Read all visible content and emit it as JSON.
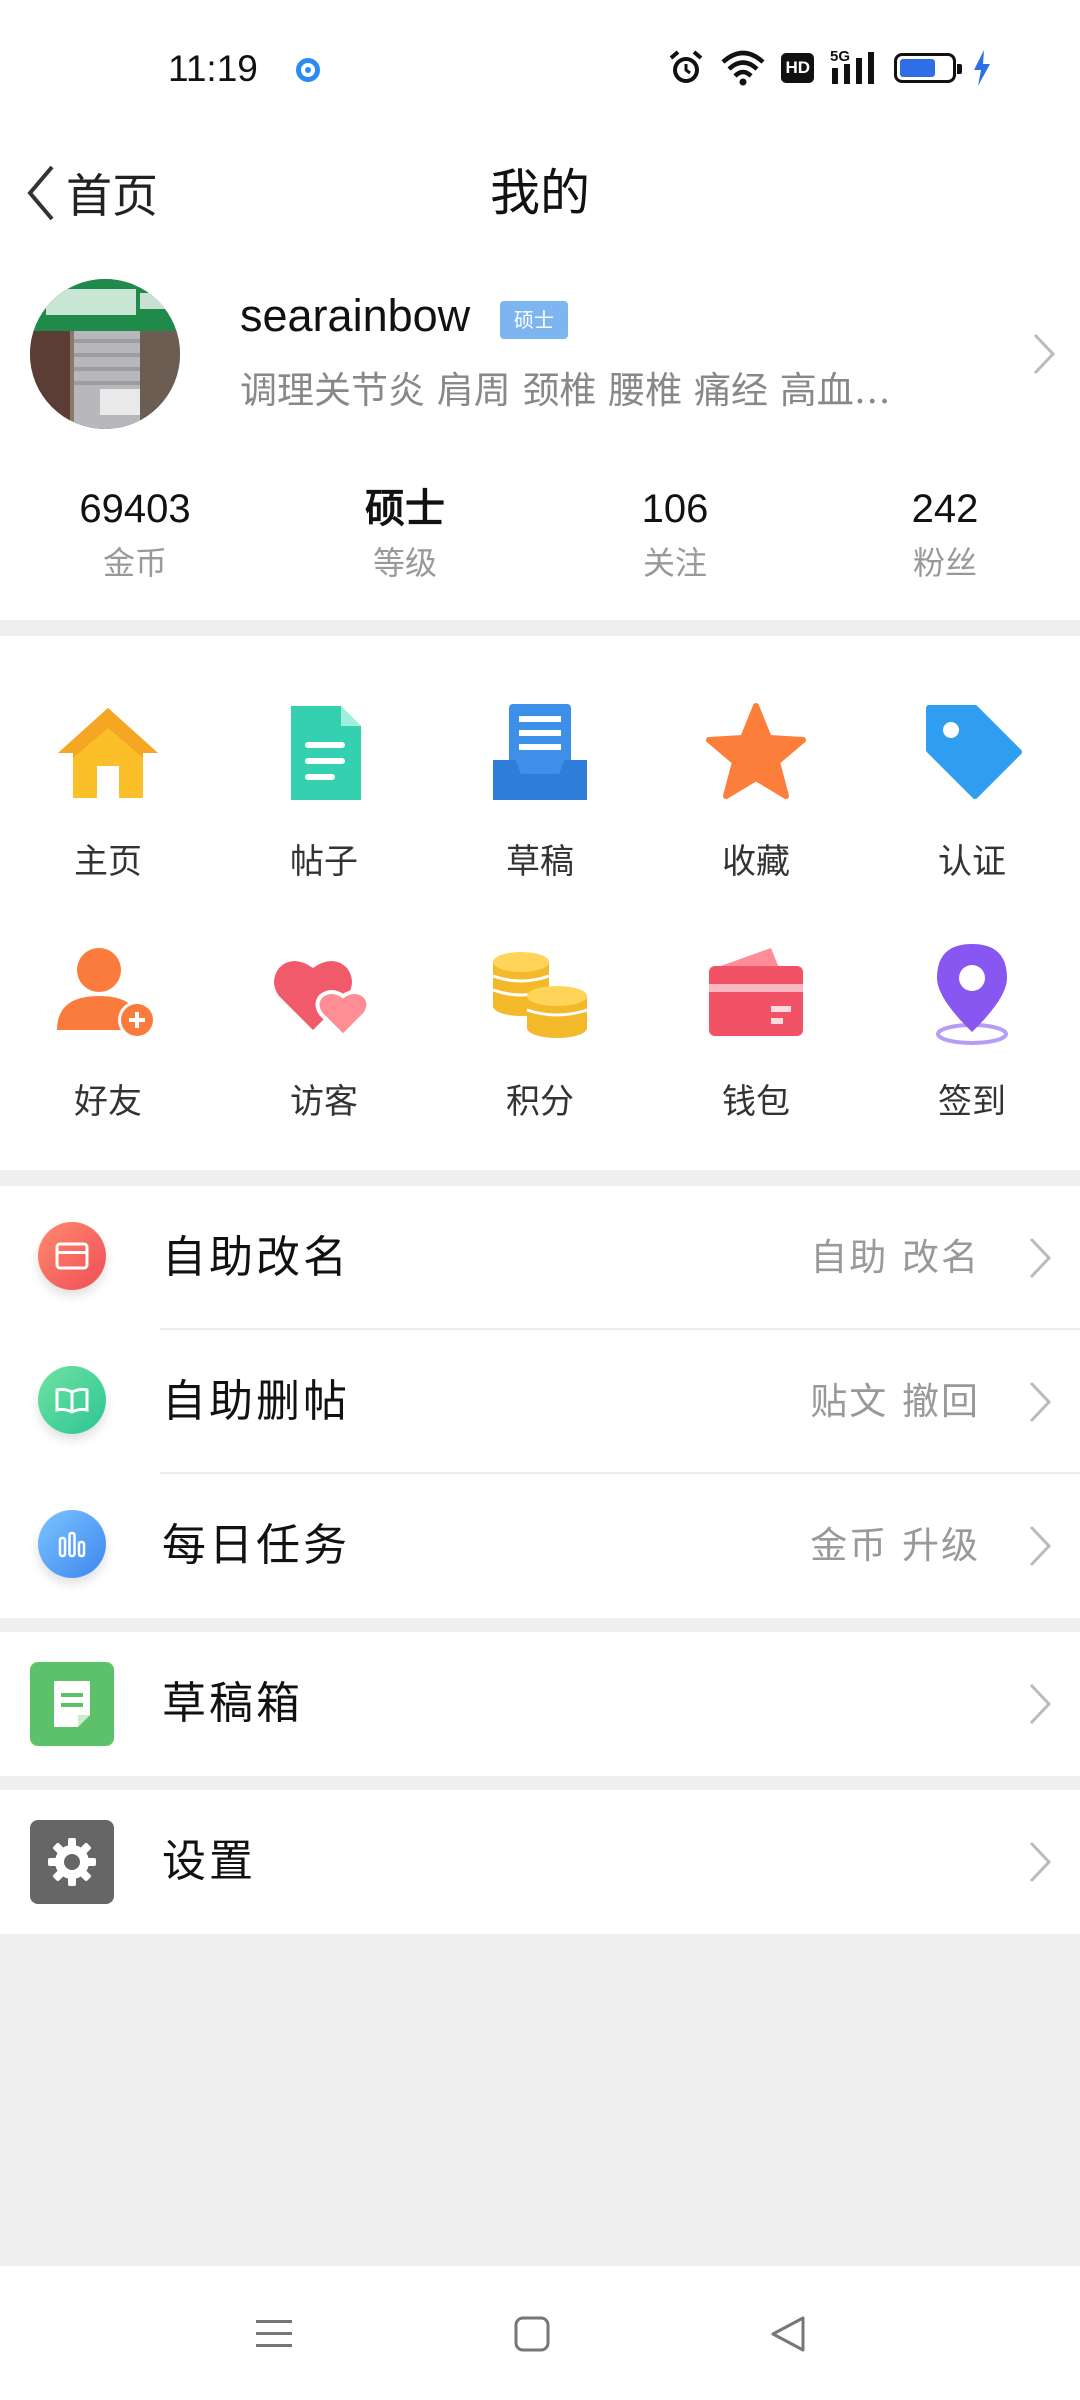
{
  "status_bar": {
    "time": "11:19",
    "hd": "HD",
    "network": "5G",
    "battery_percent": 70
  },
  "header": {
    "back_label": "首页",
    "title": "我的"
  },
  "profile": {
    "username": "searainbow",
    "level_badge": "硕士",
    "bio": "调理关节炎 肩周 颈椎 腰椎 痛经 高血…"
  },
  "stats": [
    {
      "value": "69403",
      "label": "金币"
    },
    {
      "value": "硕士",
      "label": "等级"
    },
    {
      "value": "106",
      "label": "关注"
    },
    {
      "value": "242",
      "label": "粉丝"
    }
  ],
  "grid": [
    {
      "label": "主页",
      "icon": "home-icon"
    },
    {
      "label": "帖子",
      "icon": "document-icon"
    },
    {
      "label": "草稿",
      "icon": "draft-tray-icon"
    },
    {
      "label": "收藏",
      "icon": "star-icon"
    },
    {
      "label": "认证",
      "icon": "tag-icon"
    },
    {
      "label": "好友",
      "icon": "add-friend-icon"
    },
    {
      "label": "访客",
      "icon": "hearts-icon"
    },
    {
      "label": "积分",
      "icon": "coins-icon"
    },
    {
      "label": "钱包",
      "icon": "wallet-icon"
    },
    {
      "label": "签到",
      "icon": "location-pin-icon"
    }
  ],
  "list_group1": [
    {
      "label": "自助改名",
      "value": "自助 改名",
      "icon": "card-icon",
      "color": "#f0655a"
    },
    {
      "label": "自助删帖",
      "value": "贴文 撤回",
      "icon": "book-icon",
      "color": "#3fcf8e"
    },
    {
      "label": "每日任务",
      "value": "金币 升级",
      "icon": "bar-chart-icon",
      "color": "#4c9cf5"
    }
  ],
  "drafts_row": {
    "label": "草稿箱",
    "icon": "draft-box-icon",
    "color": "#5cc168"
  },
  "settings_row": {
    "label": "设置",
    "icon": "gear-icon",
    "color": "#666666"
  },
  "colors": {
    "accent_blue": "#7db5f0",
    "page_bg": "#efefef"
  }
}
